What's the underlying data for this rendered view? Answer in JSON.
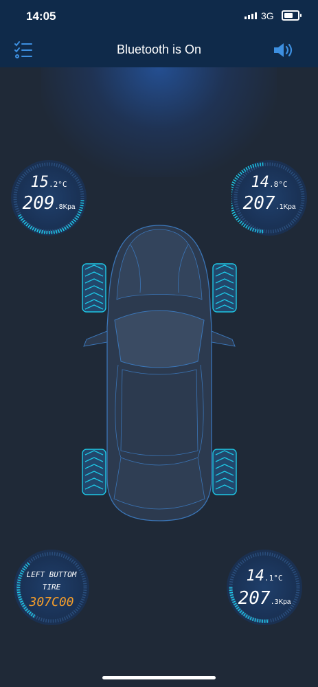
{
  "status_bar": {
    "time": "14:05",
    "network": "3G"
  },
  "header": {
    "title": "Bluetooth is On",
    "menu_icon": "checklist-icon",
    "sound_icon": "speaker-icon"
  },
  "tires": {
    "front_left": {
      "temp_int": "15",
      "temp_dec": ".2",
      "temp_unit": "°C",
      "press_int": "209",
      "press_dec": ".8",
      "press_unit": "Kpa",
      "ring_level": 0.6
    },
    "front_right": {
      "temp_int": "14",
      "temp_dec": ".8",
      "temp_unit": "°C",
      "press_int": "207",
      "press_dec": ".1",
      "press_unit": "Kpa",
      "ring_level": 0.62
    },
    "rear_left": {
      "message_line1": "LEFT BUTTOM",
      "message_line2": "TIRE",
      "code": "307C00",
      "ring_level": 0.45
    },
    "rear_right": {
      "temp_int": "14",
      "temp_dec": ".1",
      "temp_unit": "°C",
      "press_int": "207",
      "press_dec": ".3",
      "press_unit": "Kpa",
      "ring_level": 0.55
    }
  },
  "colors": {
    "accent": "#1ec8e6",
    "warning": "#f59e2b",
    "header_bg": "#0f2a4a",
    "body_bg": "#1f2937"
  }
}
